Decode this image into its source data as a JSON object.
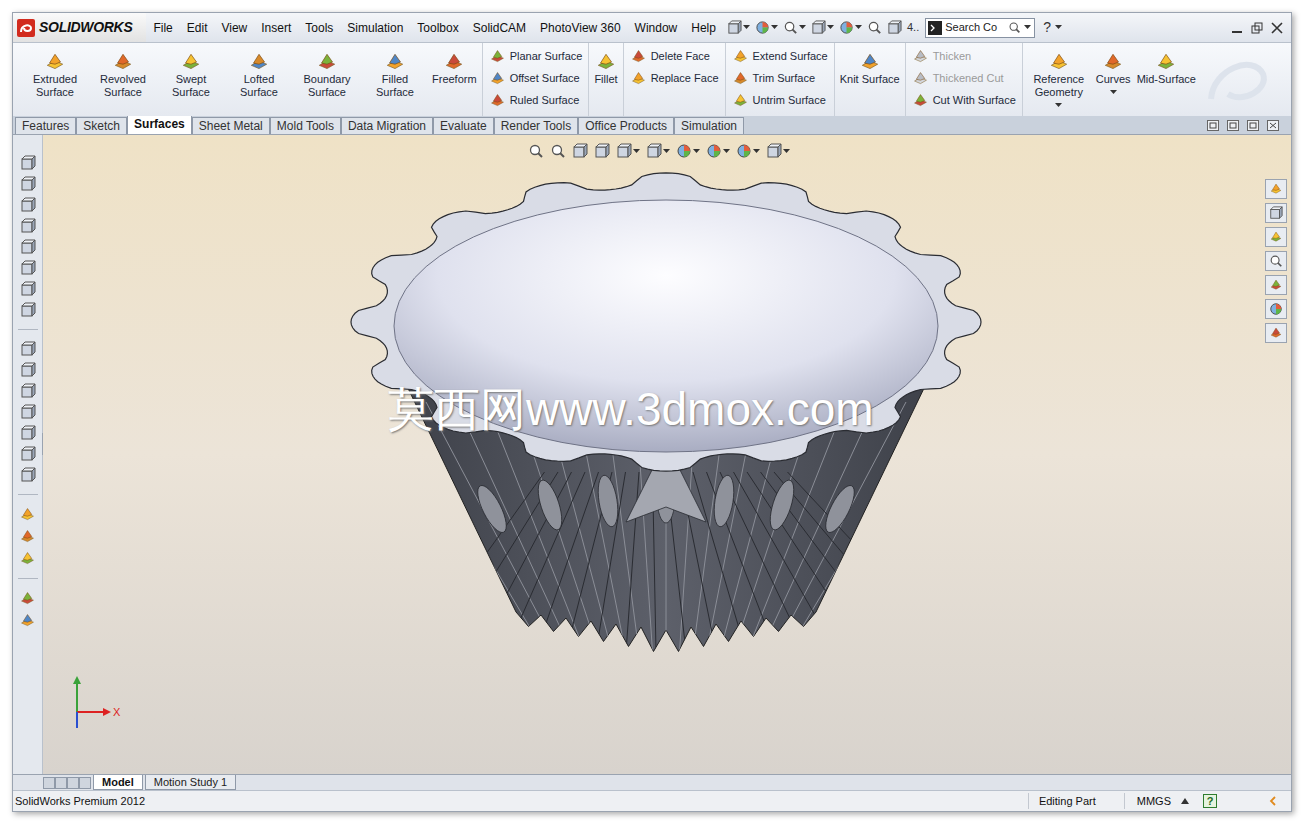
{
  "window": {
    "logo": "SOLIDWORKS",
    "menus": [
      "File",
      "Edit",
      "View",
      "Insert",
      "Tools",
      "Simulation",
      "Toolbox",
      "SolidCAM",
      "PhotoView 360",
      "Window",
      "Help"
    ],
    "toolbar_more": "4..",
    "search": {
      "placeholder": "Search Co"
    },
    "help": "?"
  },
  "command_manager": {
    "groups": [
      {
        "kind": "large",
        "items": [
          {
            "label": "Extruded Surface",
            "disabled": false,
            "has_menu": false
          },
          {
            "label": "Revolved Surface",
            "disabled": false,
            "has_menu": false
          },
          {
            "label": "Swept Surface",
            "disabled": false,
            "has_menu": false
          },
          {
            "label": "Lofted Surface",
            "disabled": false,
            "has_menu": false
          },
          {
            "label": "Boundary Surface",
            "disabled": false,
            "has_menu": false
          },
          {
            "label": "Filled Surface",
            "disabled": false,
            "has_menu": false
          },
          {
            "label": "Freeform",
            "disabled": false,
            "has_menu": false
          }
        ]
      },
      {
        "kind": "stack",
        "items": [
          {
            "label": "Planar Surface",
            "disabled": false,
            "has_menu": false
          },
          {
            "label": "Offset Surface",
            "disabled": false,
            "has_menu": false
          },
          {
            "label": "Ruled Surface",
            "disabled": false,
            "has_menu": false
          }
        ]
      },
      {
        "kind": "large",
        "items": [
          {
            "label": "Fillet",
            "disabled": false,
            "has_menu": false
          }
        ]
      },
      {
        "kind": "stack",
        "items": [
          {
            "label": "Delete Face",
            "disabled": false,
            "has_menu": false
          },
          {
            "label": "Replace Face",
            "disabled": false,
            "has_menu": false
          }
        ]
      },
      {
        "kind": "stack",
        "items": [
          {
            "label": "Extend Surface",
            "disabled": false,
            "has_menu": false
          },
          {
            "label": "Trim Surface",
            "disabled": false,
            "has_menu": false
          },
          {
            "label": "Untrim Surface",
            "disabled": false,
            "has_menu": false
          }
        ]
      },
      {
        "kind": "large",
        "items": [
          {
            "label": "Knit Surface",
            "disabled": false,
            "has_menu": false
          }
        ]
      },
      {
        "kind": "stack",
        "items": [
          {
            "label": "Thicken",
            "disabled": true,
            "has_menu": false
          },
          {
            "label": "Thickened Cut",
            "disabled": true,
            "has_menu": false
          },
          {
            "label": "Cut With Surface",
            "disabled": false,
            "has_menu": false
          }
        ]
      },
      {
        "kind": "large",
        "items": [
          {
            "label": "Reference Geometry",
            "disabled": false,
            "has_menu": true
          },
          {
            "label": "Curves",
            "disabled": false,
            "has_menu": true
          },
          {
            "label": "Mid-Surface",
            "disabled": false,
            "has_menu": false
          }
        ]
      }
    ]
  },
  "tabs": [
    {
      "label": "Features",
      "selected": false
    },
    {
      "label": "Sketch",
      "selected": false
    },
    {
      "label": "Surfaces",
      "selected": true
    },
    {
      "label": "Sheet Metal",
      "selected": false
    },
    {
      "label": "Mold Tools",
      "selected": false
    },
    {
      "label": "Data Migration",
      "selected": false
    },
    {
      "label": "Evaluate",
      "selected": false
    },
    {
      "label": "Render Tools",
      "selected": false
    },
    {
      "label": "Office Products",
      "selected": false
    },
    {
      "label": "Simulation",
      "selected": false
    }
  ],
  "viewport": {
    "watermark": "莫西网www.3dmox.com",
    "triad": {
      "x": "X"
    }
  },
  "model_tabs": [
    {
      "label": "Model",
      "selected": true
    },
    {
      "label": "Motion Study 1",
      "selected": false
    }
  ],
  "status_bar": {
    "product": "SolidWorks Premium 2012",
    "mode": "Editing Part",
    "units": "MMGS",
    "help": "?"
  }
}
